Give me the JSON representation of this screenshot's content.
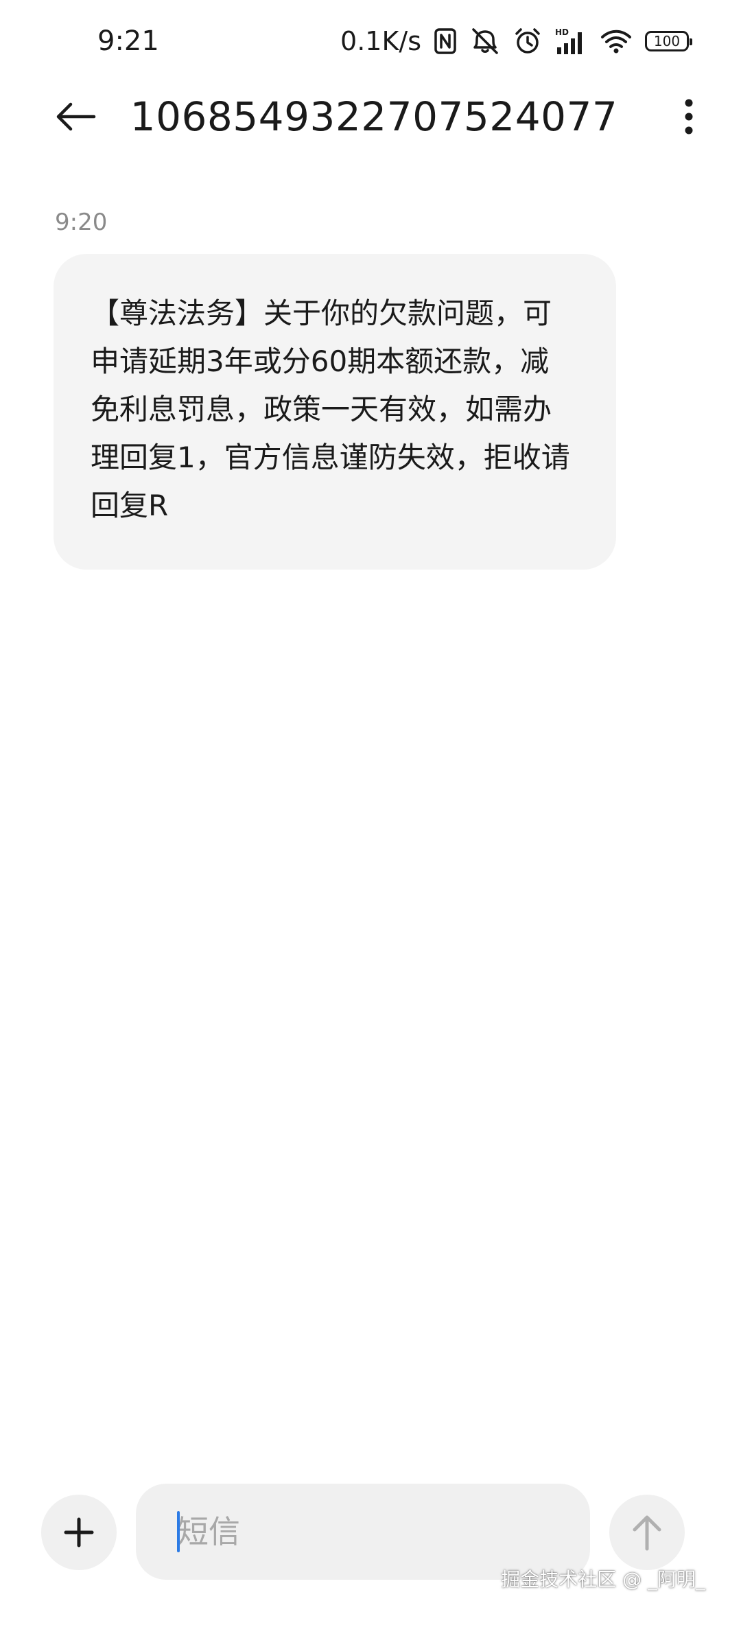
{
  "status_bar": {
    "time": "9:21",
    "net_speed": "0.1K/s",
    "battery_level": "100",
    "icons": [
      "nfc-icon",
      "mute-icon",
      "alarm-icon",
      "hd-signal-icon",
      "wifi-icon",
      "battery-icon"
    ]
  },
  "app_bar": {
    "title": "1068549322707524077",
    "back_icon": "arrow-left-icon",
    "more_icon": "more-vertical-icon"
  },
  "conversation": {
    "messages": [
      {
        "timestamp": "9:20",
        "text": "【尊法法务】关于你的欠款问题，可申请延期3年或分60期本额还款，减免利息罚息，政策一天有效，如需办理回复1，官方信息谨防失效，拒收请回复R"
      }
    ]
  },
  "compose": {
    "placeholder": "短信",
    "value": "",
    "attach_icon": "plus-icon",
    "send_icon": "arrow-up-icon"
  },
  "watermark": "掘金技术社区 @ _阿明_",
  "colors": {
    "bubble_bg": "#f4f4f4",
    "control_bg": "#f0f0f0",
    "caret": "#2c7be5",
    "text": "#1a1a1a",
    "muted": "#8a8a8a",
    "icon_disabled": "#b0b0b0"
  }
}
